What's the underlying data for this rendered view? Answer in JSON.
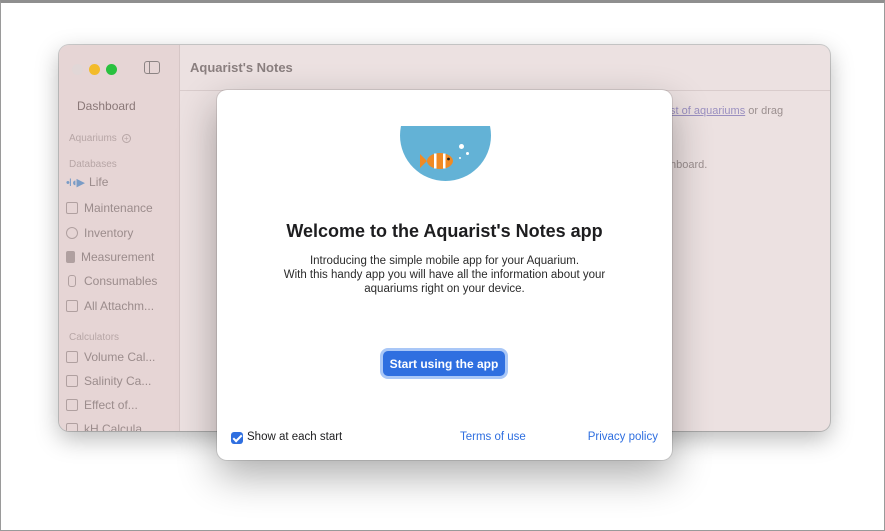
{
  "window": {
    "title": "Aquarist's Notes"
  },
  "sidebar": {
    "dashboard": "Dashboard",
    "aquariums_header": "Aquariums",
    "databases_header": "Databases",
    "databases": [
      {
        "label": "Life",
        "icon": "fish-icon"
      },
      {
        "label": "Maintenance",
        "icon": "calendar-icon"
      },
      {
        "label": "Inventory",
        "icon": "inventory-icon"
      },
      {
        "label": "Measurement",
        "icon": "test-tubes-icon"
      },
      {
        "label": "Consumables",
        "icon": "bottle-icon"
      },
      {
        "label": "All Attachm...",
        "icon": "attachment-icon"
      }
    ],
    "calculators_header": "Calculators",
    "calculators": [
      {
        "label": "Volume Cal...",
        "icon": "cube-icon"
      },
      {
        "label": "Salinity Ca...",
        "icon": "calculator-icon"
      },
      {
        "label": "Effect of...",
        "icon": "calculator-icon"
      },
      {
        "label": "kH Calcula...",
        "icon": "calculator-icon"
      }
    ]
  },
  "background": {
    "link_text": "st of aquariums",
    "trailing_text": " or drag",
    "line2": "hboard."
  },
  "dialog": {
    "title": "Welcome to the Aquarist's Notes app",
    "description_lines": [
      "Introducing the simple mobile app for your Aquarium.",
      "With this handy app you will have all the  information about your",
      "aquariums right on your device."
    ],
    "start_button": "Start using the app",
    "show_at_start_label": "Show at each start",
    "show_at_start_checked": true,
    "terms_link": "Terms of use",
    "privacy_link": "Privacy policy"
  },
  "colors": {
    "accent": "#2f6fe0",
    "bowl": "#63b2d6",
    "fish": "#f08a24"
  }
}
